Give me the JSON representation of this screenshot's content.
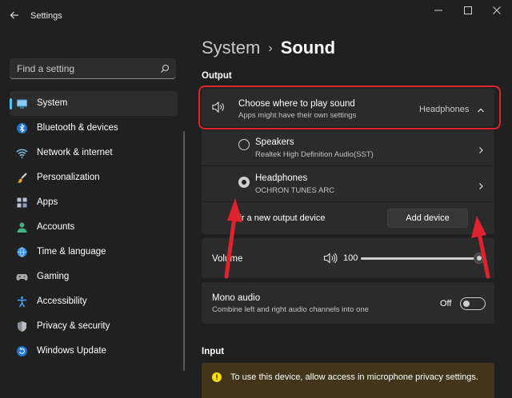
{
  "window": {
    "title": "Settings",
    "back_icon": "back-arrow-icon",
    "controls": [
      "minimize-icon",
      "maximize-icon",
      "close-icon"
    ]
  },
  "sidebar": {
    "search": {
      "placeholder": "Find a setting",
      "icon": "search-icon"
    },
    "items": [
      {
        "label": "System",
        "icon": "monitor-icon",
        "active": true
      },
      {
        "label": "Bluetooth & devices",
        "icon": "bluetooth-icon"
      },
      {
        "label": "Network & internet",
        "icon": "wifi-icon"
      },
      {
        "label": "Personalization",
        "icon": "brush-icon"
      },
      {
        "label": "Apps",
        "icon": "apps-icon"
      },
      {
        "label": "Accounts",
        "icon": "person-icon"
      },
      {
        "label": "Time & language",
        "icon": "globe-clock-icon"
      },
      {
        "label": "Gaming",
        "icon": "gamepad-icon"
      },
      {
        "label": "Accessibility",
        "icon": "accessibility-icon"
      },
      {
        "label": "Privacy & security",
        "icon": "shield-icon"
      },
      {
        "label": "Windows Update",
        "icon": "update-icon"
      }
    ]
  },
  "breadcrumb": {
    "parent": "System",
    "separator": "›",
    "current": "Sound"
  },
  "output": {
    "section_title": "Output",
    "choose": {
      "title": "Choose where to play sound",
      "subtitle": "Apps might have their own settings",
      "value": "Headphones"
    },
    "devices": [
      {
        "name": "Speakers",
        "detail": "Realtek High Definition Audio(SST)",
        "selected": false
      },
      {
        "name": "Headphones",
        "detail": "OCHRON TUNES ARC",
        "selected": true
      }
    ],
    "pair": {
      "label": "Pair a new output device",
      "button": "Add device"
    },
    "volume": {
      "label": "Volume",
      "value": "100",
      "level": 1.0
    },
    "mono": {
      "title": "Mono audio",
      "subtitle": "Combine left and right audio channels into one",
      "state": "Off"
    }
  },
  "input": {
    "section_title": "Input",
    "warning": "To use this device, allow access in microphone privacy settings."
  },
  "colors": {
    "accent": "#4cc2ff",
    "highlight_border": "#e0222e",
    "annotation_arrow": "#e0222e",
    "warning_bg": "#433519",
    "warning_icon": "#fce100"
  }
}
